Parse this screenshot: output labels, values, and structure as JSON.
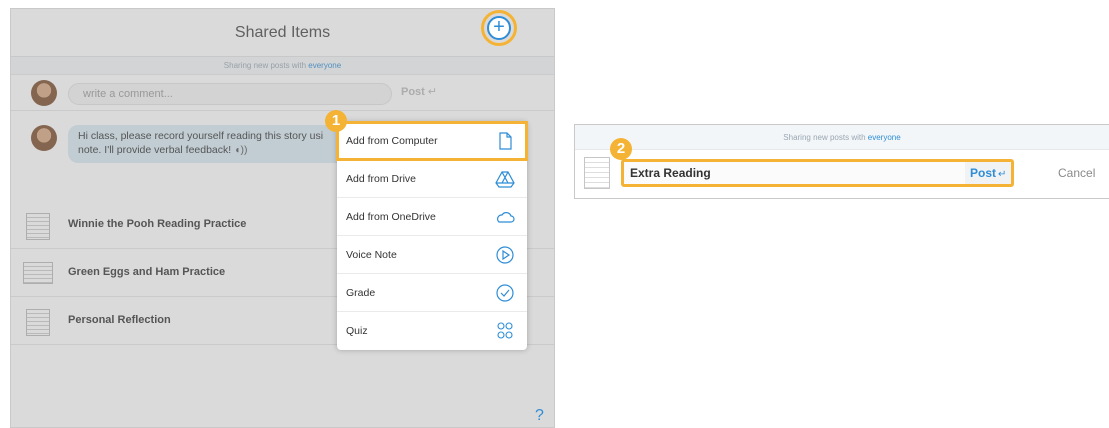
{
  "left_panel": {
    "title": "Shared Items",
    "sharing_prefix": "Sharing new posts with",
    "sharing_audience": "everyone",
    "comment_placeholder": "write a comment...",
    "post_label": "Post",
    "message_line1": "Hi class, please record yourself reading this story usi",
    "message_line2": "note. I'll provide verbal feedback!",
    "items": [
      {
        "title": "Winnie the Pooh Reading Practice"
      },
      {
        "title": "Green Eggs and Ham Practice"
      },
      {
        "title": "Personal Reflection"
      }
    ],
    "help": "?"
  },
  "menu": {
    "items": [
      {
        "label": "Add from Computer",
        "icon": "document-icon"
      },
      {
        "label": "Add from Drive",
        "icon": "drive-icon"
      },
      {
        "label": "Add from OneDrive",
        "icon": "cloud-icon"
      },
      {
        "label": "Voice Note",
        "icon": "voice-note-icon"
      },
      {
        "label": "Grade",
        "icon": "check-circle-icon"
      },
      {
        "label": "Quiz",
        "icon": "quiz-icon"
      }
    ]
  },
  "right_panel": {
    "sharing_prefix": "Sharing new posts with",
    "sharing_audience": "everyone",
    "title_value": "Extra Reading",
    "post_label": "Post",
    "cancel_label": "Cancel"
  },
  "badges": {
    "step1": "1",
    "step2": "2"
  },
  "colors": {
    "accent": "#2e8dd6",
    "highlight": "#f5b335",
    "bubble": "#d9ebf5"
  }
}
